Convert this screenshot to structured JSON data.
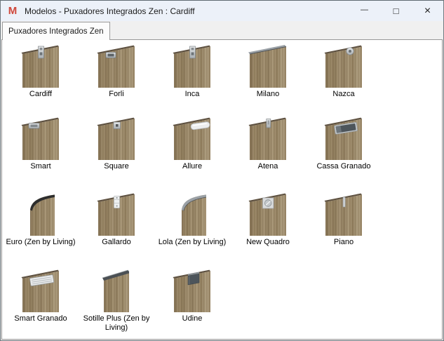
{
  "window": {
    "title": "Modelos - Puxadores Integrados Zen : Cardiff",
    "icon_glyph": "M",
    "controls": {
      "minimize": "—",
      "maximize": "□",
      "close": "×"
    }
  },
  "tabs": [
    {
      "label": "Puxadores Integrados Zen",
      "selected": true
    }
  ],
  "models": {
    "selected": "Cardiff",
    "columns_per_row": 5,
    "items": [
      {
        "label": "Cardiff",
        "door": "std",
        "handle": "vrect"
      },
      {
        "label": "Forli",
        "door": "std",
        "handle": "hrect"
      },
      {
        "label": "Inca",
        "door": "std",
        "handle": "vrect"
      },
      {
        "label": "Milano",
        "door": "std",
        "handle": "top-strip-metal"
      },
      {
        "label": "Nazca",
        "door": "std",
        "handle": "round"
      },
      {
        "label": "Smart",
        "door": "std",
        "handle": "hrect2"
      },
      {
        "label": "Square",
        "door": "std",
        "handle": "square"
      },
      {
        "label": "Allure",
        "door": "std",
        "handle": "pill"
      },
      {
        "label": "Atena",
        "door": "std",
        "handle": "vrect-sm"
      },
      {
        "label": "Cassa Granado",
        "door": "std",
        "handle": "dark-hrect"
      },
      {
        "label": "Euro (Zen by Living)",
        "door": "curved",
        "handle": "curved-dark"
      },
      {
        "label": "Gallardo",
        "door": "std",
        "handle": "vrect-white"
      },
      {
        "label": "Lola (Zen by Living)",
        "door": "curved",
        "handle": "curved-metal"
      },
      {
        "label": "New Quadro",
        "door": "std",
        "handle": "sq-hole"
      },
      {
        "label": "Piano",
        "door": "std",
        "handle": "vline"
      },
      {
        "label": "Smart Granado",
        "door": "std",
        "handle": "striped"
      },
      {
        "label": "Sotille Plus (Zen by Living)",
        "door": "tall",
        "handle": "top-strip-dark"
      },
      {
        "label": "Udine",
        "door": "std",
        "handle": "dark-square"
      }
    ]
  },
  "colors": {
    "titlebar_bg": "#ecf1f9",
    "strip_bg": "#f0f0f0",
    "content_bg": "#ffffff",
    "border_gray": "#989898",
    "icon_red": "#cd4a3f",
    "wood_dark": "#806d50",
    "wood_light": "#ab9a7b",
    "metal": "#9ba1a6",
    "handle_dark": "#4d555b",
    "handle_white": "#eff1f1"
  }
}
